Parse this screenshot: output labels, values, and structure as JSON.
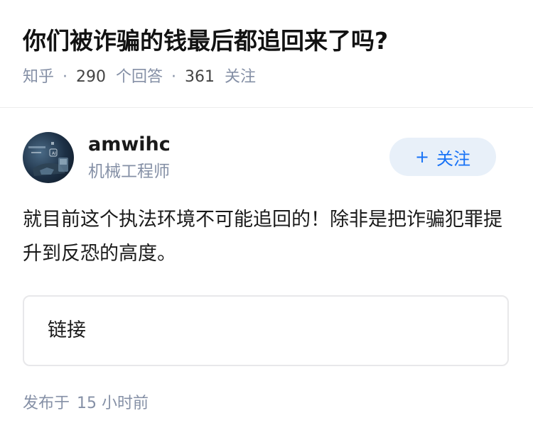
{
  "question": {
    "title": "你们被诈骗的钱最后都追回来了吗?",
    "source": "知乎",
    "separator": "·",
    "answer_count": "290",
    "answer_count_label": "个回答",
    "follower_count": "361",
    "follower_count_label": "关注"
  },
  "answer": {
    "author": {
      "name": "amwihc",
      "headline": "机械工程师"
    },
    "follow_button": {
      "icon": "plus-icon",
      "plus": "+",
      "label": "关注"
    },
    "content": "就目前这个执法环境不可能追回的！除非是把诈骗犯罪提升到反恐的高度。",
    "link_card": {
      "label": "链接"
    },
    "publish": {
      "prefix": "发布于",
      "time_value": "15",
      "time_unit": "小时前"
    }
  },
  "colors": {
    "meta_text": "#8590a6",
    "accent": "#1772f6",
    "follow_bg": "#e8f0f9",
    "divider": "#ececec",
    "card_border": "#e8e8ea"
  }
}
